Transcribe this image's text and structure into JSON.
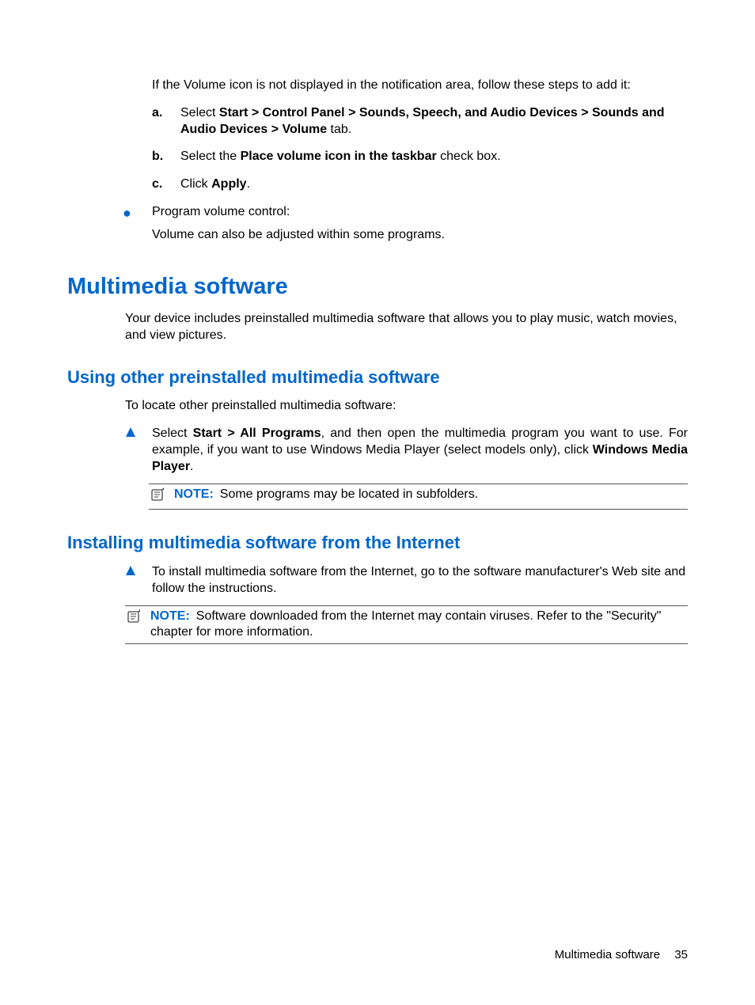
{
  "intro_para": "If the Volume icon is not displayed in the notification area, follow these steps to add it:",
  "sublist": {
    "a": {
      "marker": "a.",
      "pre": "Select ",
      "bold1": "Start > Control Panel > Sounds, Speech, and Audio Devices > Sounds and Audio Devices > Volume",
      "post": " tab."
    },
    "b": {
      "marker": "b.",
      "pre": "Select the ",
      "bold1": "Place volume icon in the taskbar",
      "post": " check box."
    },
    "c": {
      "marker": "c.",
      "pre": "Click ",
      "bold1": "Apply",
      "post": "."
    }
  },
  "outer": {
    "title": "Program volume control:",
    "body": "Volume can also be adjusted within some programs."
  },
  "h1": "Multimedia software",
  "h1_para": "Your device includes preinstalled multimedia software that allows you to play music, watch movies, and view pictures.",
  "sub1": {
    "title": "Using other preinstalled multimedia software",
    "para": "To locate other preinstalled multimedia software:",
    "tri": {
      "pre": "Select ",
      "bold1": "Start > All Programs",
      "mid": ", and then open the multimedia program you want to use. For example, if you want to use Windows Media Player (select models only), click ",
      "bold2": "Windows Media Player",
      "post": "."
    },
    "note": {
      "label": "NOTE:",
      "text": "Some programs may be located in subfolders."
    }
  },
  "sub2": {
    "title": "Installing multimedia software from the Internet",
    "tri": "To install multimedia software from the Internet, go to the software manufacturer's Web site and follow the instructions.",
    "note": {
      "label": "NOTE:",
      "text": "Software downloaded from the Internet may contain viruses. Refer to the \"Security\" chapter for more information."
    }
  },
  "footer": {
    "title": "Multimedia software",
    "page": "35"
  }
}
